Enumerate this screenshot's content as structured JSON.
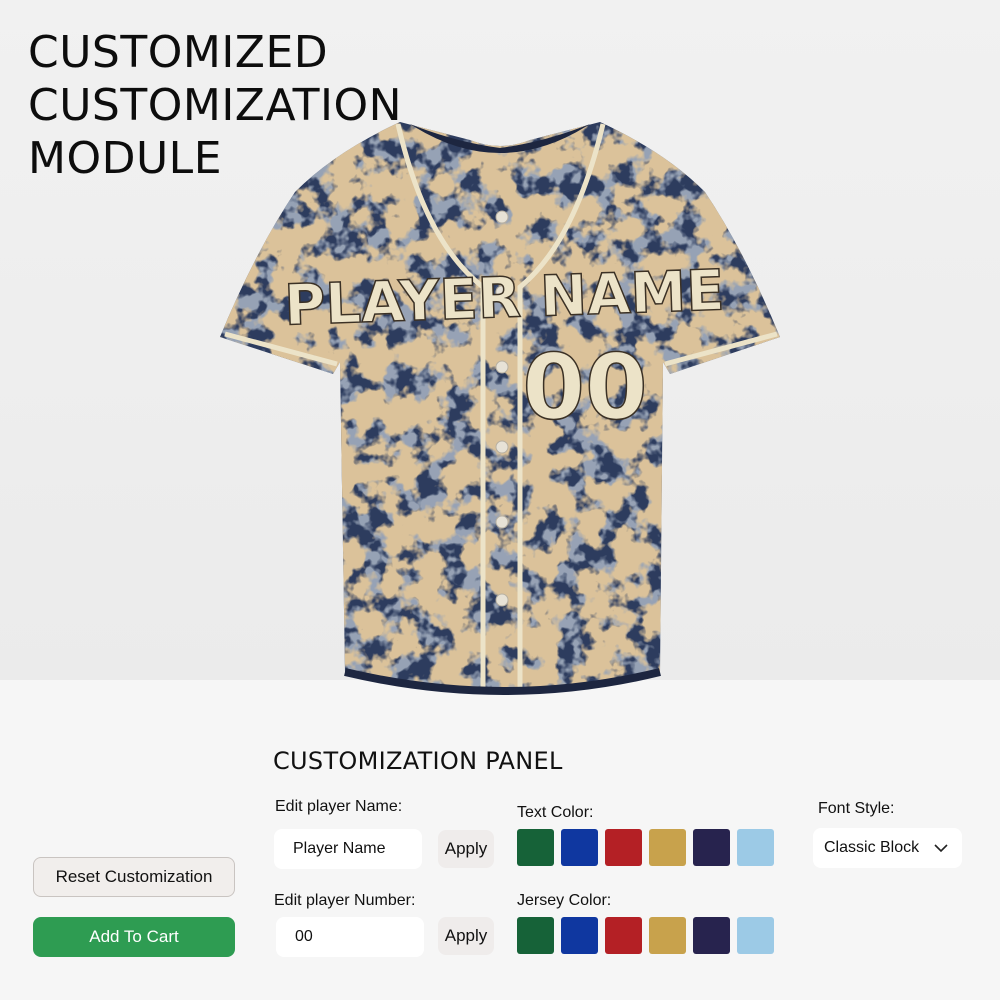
{
  "page": {
    "title_lines": [
      "CUSTOMIZED",
      "CUSTOMIZATION",
      "MODULE"
    ]
  },
  "jersey": {
    "name_text": "PLAYER NAME",
    "number_text": "00",
    "color": "#2d3c5e",
    "distress_color": "#b48a52",
    "trim_color": "#ece3c8"
  },
  "panel": {
    "title": "CUSTOMIZATION PANEL",
    "name_field": {
      "label": "Edit player Name:",
      "value": "Player Name",
      "apply_label": "Apply"
    },
    "number_field": {
      "label": "Edit player Number:",
      "value": "00",
      "apply_label": "Apply"
    },
    "text_color": {
      "label": "Text Color:",
      "swatches": [
        "#166238",
        "#0f37a0",
        "#b42025",
        "#c8a24c",
        "#27234e",
        "#9ccae6"
      ]
    },
    "jersey_color": {
      "label": "Jersey Color:",
      "swatches": [
        "#166238",
        "#0f37a0",
        "#b42025",
        "#c8a24c",
        "#27234e",
        "#9ccae6"
      ]
    },
    "font_style": {
      "label": "Font Style:",
      "selected": "Classic Block",
      "icon": "chevron-down-icon"
    }
  },
  "actions": {
    "reset_label": "Reset Customization",
    "cart_label": "Add To Cart",
    "cart_color": "#2e9c52"
  }
}
